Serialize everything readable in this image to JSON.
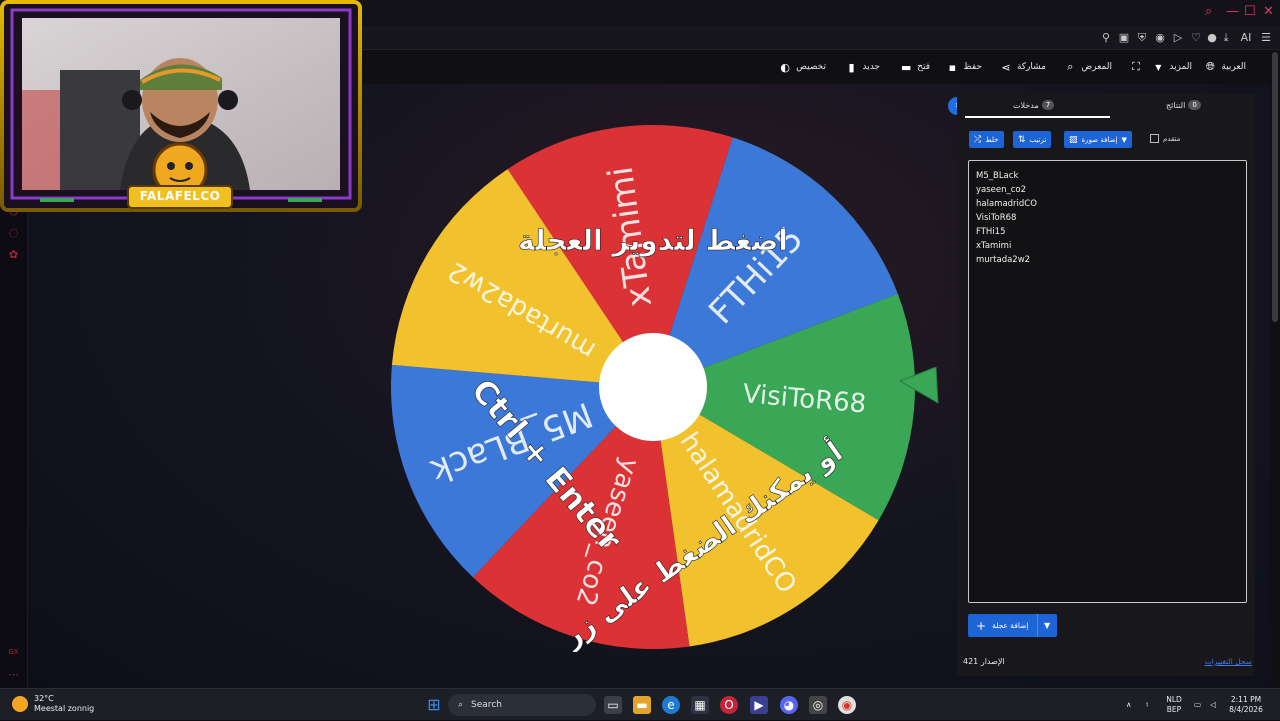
{
  "toolbar": {
    "language": "العربية",
    "more": "المزيد",
    "gallery": "المعرض",
    "share": "مشاركة",
    "save": "حفظ",
    "open": "فتح",
    "new": "جديد",
    "customize": "تخصيص"
  },
  "panel": {
    "tab_entries_label": "مدخلات",
    "tab_entries_count": "7",
    "tab_results_label": "النتائج",
    "tab_results_count": "0",
    "shuffle_label": "خلط",
    "sort_label": "ترتيب",
    "add_image_label": "إضافة صورة",
    "advanced_label": "متقدم",
    "entries": [
      "M5_BLack",
      "yaseen_co2",
      "halamadridCO",
      "VisiToR68",
      "FTHi15",
      "xTamimi",
      "murtada2w2"
    ],
    "add_wheel_label": "إضافة عجلة",
    "version_label": "الإصدار",
    "version_number": "421",
    "changelog_label": "سجل التغييرات"
  },
  "wheel": {
    "segments": [
      {
        "name": "xTamimi",
        "color": "#db3236"
      },
      {
        "name": "FTHi15",
        "color": "#3c78d8"
      },
      {
        "name": "VisiToR68",
        "color": "#3aa757"
      },
      {
        "name": "halamadridCO",
        "color": "#f2c12e"
      },
      {
        "name": "yaseen_co2",
        "color": "#db3236"
      },
      {
        "name": "M5_BLack",
        "color": "#3c78d8"
      },
      {
        "name": "murtada2w2",
        "color": "#f2c12e"
      }
    ],
    "instruction_top": "اضغط لتدوير العجلة",
    "instruction_bottom": "أو يمكنك الضغط على زر",
    "shortcut": "Ctrl + Enter",
    "pointer_color": "#3aa757"
  },
  "webcam": {
    "logo_text": "FALAFELCO"
  },
  "taskbar": {
    "temperature": "32°C",
    "weather": "Meestal zonnig",
    "search_placeholder": "Search",
    "lang_1": "NLD",
    "lang_2": "BEP",
    "time": "2:11 PM",
    "date": "8/4/2026"
  },
  "tabbar": {
    "ai_label": "AI"
  }
}
